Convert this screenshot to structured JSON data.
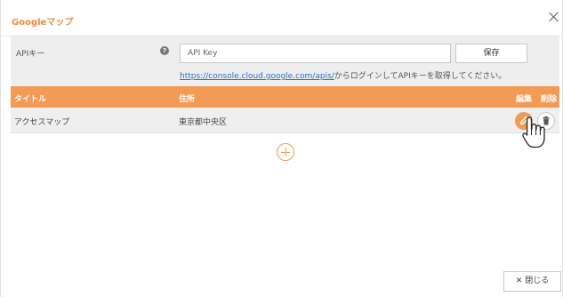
{
  "dialog": {
    "title": "Googleマップ",
    "close_icon": "close-icon"
  },
  "api": {
    "label": "APIキー",
    "help_icon": "question-circle-icon",
    "help_glyph": "?",
    "input_value": "",
    "input_placeholder": "API Key",
    "save_label": "保存",
    "link_text": "https://console.cloud.google.com/apis/",
    "help_text_suffix": "からログインしてAPIキーを取得してください。"
  },
  "table": {
    "headers": {
      "title": "タイトル",
      "address": "住所",
      "edit": "編集",
      "delete": "削除"
    },
    "rows": [
      {
        "title": "アクセスマップ",
        "address": "東京都中央区"
      }
    ]
  },
  "actions": {
    "add_icon": "plus-circle-icon",
    "close_button": "✕ 閉じる"
  },
  "colors": {
    "accent": "#f39a54",
    "title": "#f08b3c",
    "link": "#2b6fc4",
    "api_bg": "#eeeeee",
    "row_bg": "#efefef"
  }
}
